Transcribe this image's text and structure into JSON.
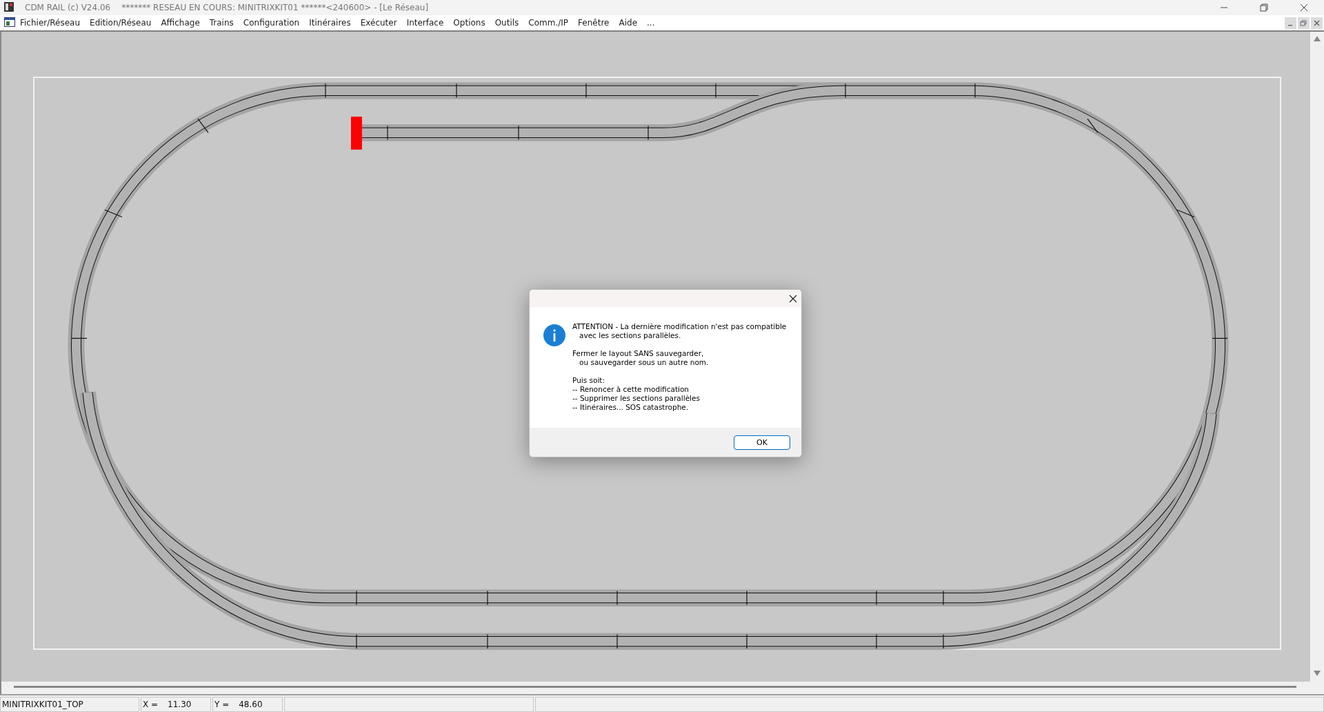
{
  "window": {
    "app_title": "CDM RAIL (c) V24.06",
    "document_title": "******* RESEAU EN COURS: MINITRIXKIT01 ******<240600> - [Le Réseau]"
  },
  "menu": [
    "Fichier/Réseau",
    "Edition/Réseau",
    "Affichage",
    "Trains",
    "Configuration",
    "Itinéraires",
    "Exécuter",
    "Interface",
    "Options",
    "Outils",
    "Comm./IP",
    "Fenêtre",
    "Aide",
    "..."
  ],
  "dialog": {
    "paragraphs": [
      "ATTENTION - La dernière modification n'est pas compatible\n   avec les sections parallèles.",
      "Fermer le layout SANS sauvegarder,\n   ou sauvegarder sous un autre nom.",
      "Puis soit:\n-- Renoncer à cette modification\n-- Supprimer les sections parallèles\n-- Itinéraires... SOS catastrophe."
    ],
    "button": "OK"
  },
  "status_bar": {
    "layout_name": "MINITRIXKIT01_TOP",
    "x_label": "X =",
    "x_value": "11.30",
    "y_label": "Y =",
    "y_value": "48.60"
  }
}
